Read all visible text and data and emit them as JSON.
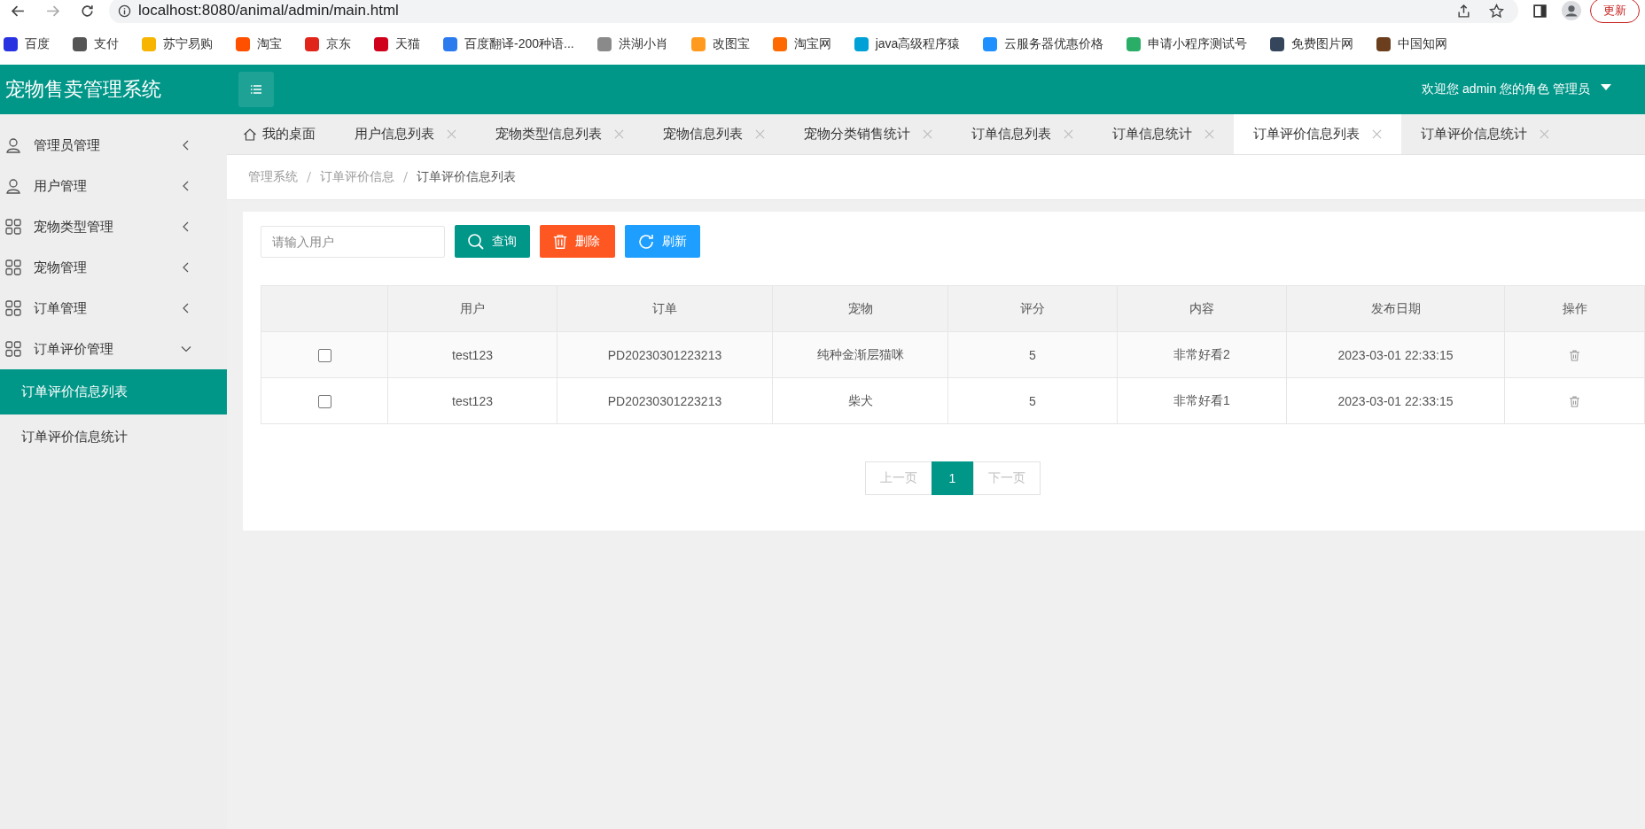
{
  "browser": {
    "url": "localhost:8080/animal/admin/main.html",
    "update_button": "更新",
    "bookmarks": [
      {
        "label": "百度",
        "color": "#2932e1"
      },
      {
        "label": "支付",
        "color": "#555555"
      },
      {
        "label": "苏宁易购",
        "color": "#f7b500"
      },
      {
        "label": "淘宝",
        "color": "#ff5000"
      },
      {
        "label": "京东",
        "color": "#e1251b"
      },
      {
        "label": "天猫",
        "color": "#d0021b"
      },
      {
        "label": "百度翻译-200种语...",
        "color": "#2b7bef"
      },
      {
        "label": "洪湖小肖",
        "color": "#8a8a8a"
      },
      {
        "label": "改图宝",
        "color": "#ff9a1f"
      },
      {
        "label": "淘宝网",
        "color": "#ff6a00"
      },
      {
        "label": "java高级程序猿",
        "color": "#00a1d6"
      },
      {
        "label": "云服务器优惠价格",
        "color": "#1e90ff"
      },
      {
        "label": "申请小程序测试号",
        "color": "#2aae67"
      },
      {
        "label": "免费图片网",
        "color": "#35465c"
      },
      {
        "label": "中国知网",
        "color": "#6b3e1e"
      }
    ]
  },
  "header": {
    "title": "宠物售卖管理系统",
    "user_info": "欢迎您 admin 您的角色 管理员"
  },
  "sidebar": {
    "items": [
      {
        "label": "管理员管理",
        "expanded": false
      },
      {
        "label": "用户管理",
        "expanded": false
      },
      {
        "label": "宠物类型管理",
        "expanded": false
      },
      {
        "label": "宠物管理",
        "expanded": false
      },
      {
        "label": "订单管理",
        "expanded": false
      },
      {
        "label": "订单评价管理",
        "expanded": true,
        "children": [
          {
            "label": "订单评价信息列表",
            "selected": true
          },
          {
            "label": "订单评价信息统计",
            "selected": false
          }
        ]
      }
    ]
  },
  "tabs": [
    {
      "kind": "home",
      "label": "我的桌面",
      "selected": false
    },
    {
      "kind": "page",
      "label": "用户信息列表",
      "selected": false
    },
    {
      "kind": "page",
      "label": "宠物类型信息列表",
      "selected": false
    },
    {
      "kind": "page",
      "label": "宠物信息列表",
      "selected": false
    },
    {
      "kind": "page",
      "label": "宠物分类销售统计",
      "selected": false
    },
    {
      "kind": "page",
      "label": "订单信息列表",
      "selected": false
    },
    {
      "kind": "page",
      "label": "订单信息统计",
      "selected": false
    },
    {
      "kind": "page",
      "label": "订单评价信息列表",
      "selected": true
    },
    {
      "kind": "page",
      "label": "订单评价信息统计",
      "selected": false
    }
  ],
  "breadcrumb": [
    "管理系统",
    "订单评价信息",
    "订单评价信息列表"
  ],
  "toolbar": {
    "search": {
      "placeholder": "请输入用户"
    },
    "buttons": [
      {
        "kind": "search",
        "label": "查询"
      },
      {
        "kind": "delete",
        "label": "删除"
      },
      {
        "kind": "refresh",
        "label": "刷新"
      }
    ]
  },
  "table": {
    "columns": [
      "用户",
      "订单",
      "宠物",
      "评分",
      "内容",
      "发布日期",
      "操作"
    ],
    "rows": [
      {
        "checked": false,
        "cells": [
          "test123",
          "PD20230301223213",
          "纯种金渐层猫咪",
          "5",
          "非常好看2",
          "2023-03-01 22:33:15"
        ]
      },
      {
        "checked": false,
        "cells": [
          "test123",
          "PD20230301223213",
          "柴犬",
          "5",
          "非常好看1",
          "2023-03-01 22:33:15"
        ]
      }
    ]
  },
  "pagination": {
    "prev": {
      "label": "上一页",
      "disabled": true
    },
    "pages": [
      {
        "label": "1",
        "selected": true
      }
    ],
    "next": {
      "label": "下一页",
      "disabled": true
    }
  }
}
